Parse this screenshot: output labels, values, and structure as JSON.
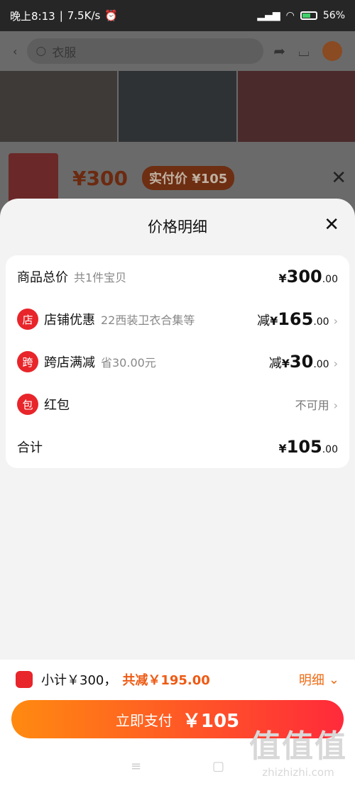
{
  "status": {
    "time": "晚上8:13",
    "speed": "7.5K/s",
    "battery": "56%"
  },
  "background": {
    "search_text": "衣服",
    "price": "¥300",
    "tag": "实付价 ¥105"
  },
  "sheet": {
    "title": "价格明细",
    "rows": [
      {
        "label": "商品总价",
        "sub": "共1件宝贝",
        "prefix": "",
        "currency": "¥",
        "amount": "300",
        "decimal": ".00"
      },
      {
        "icon": "店",
        "label": "店铺优惠",
        "sub": "22西装卫衣合集等",
        "prefix": "减",
        "currency": "¥",
        "amount": "165",
        "decimal": ".00"
      },
      {
        "icon": "跨",
        "label": "跨店满减",
        "sub": "省30.00元",
        "prefix": "减",
        "currency": "¥",
        "amount": "30",
        "decimal": ".00"
      },
      {
        "icon": "包",
        "label": "红包",
        "value": "不可用"
      },
      {
        "label": "合计",
        "currency": "¥",
        "amount": "105",
        "decimal": ".00"
      }
    ]
  },
  "summary": {
    "subtotal": "小计￥300，",
    "discount": "共减￥195.00",
    "detail_label": "明细"
  },
  "pay": {
    "label": "立即支付",
    "amount": "￥105"
  },
  "watermark": {
    "logo": "值值值",
    "site": "zhizhizhi.com"
  },
  "colors": {
    "accent": "#ee6a14",
    "red": "#e8252a"
  }
}
